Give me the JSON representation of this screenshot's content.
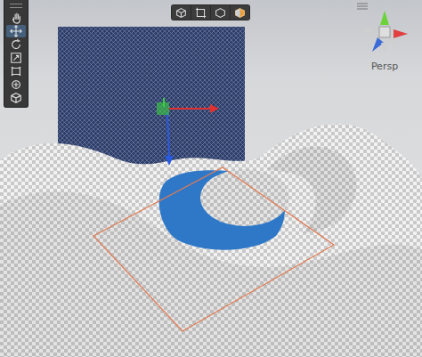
{
  "scene_view": {
    "camera_label": "Persp"
  },
  "tools": [
    {
      "kind": "hand",
      "selected": false
    },
    {
      "kind": "move",
      "selected": true
    },
    {
      "kind": "rotate",
      "selected": false
    },
    {
      "kind": "scale",
      "selected": false
    },
    {
      "kind": "rect",
      "selected": false
    },
    {
      "kind": "transform",
      "selected": false
    },
    {
      "kind": "custom",
      "selected": false
    }
  ],
  "overlay_toolbar": [
    {
      "kind": "cube",
      "selected": false
    },
    {
      "kind": "rect",
      "selected": false
    },
    {
      "kind": "cube-outline",
      "selected": false
    },
    {
      "kind": "lighting",
      "selected": false
    }
  ]
}
